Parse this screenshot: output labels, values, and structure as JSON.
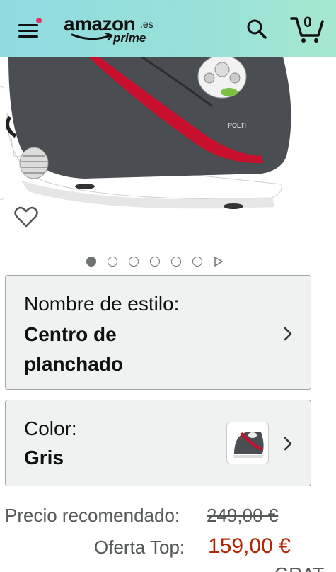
{
  "header": {
    "logo_word": "amazon",
    "logo_tld": ".es",
    "logo_sub": "prime",
    "cart_count": "0",
    "icons": [
      "hamburger-menu-icon",
      "notification-dot-icon",
      "search-icon",
      "cart-icon"
    ]
  },
  "image": {
    "brand_mark": "POLTI",
    "carousel": {
      "total": 6,
      "active_index": 0,
      "has_video": true
    }
  },
  "style_option": {
    "label": "Nombre de estilo:",
    "value_line1": "Centro de",
    "value_line2": "planchado"
  },
  "color_option": {
    "label": "Color:",
    "value": "Gris"
  },
  "price": {
    "recommended_label": "Precio recomendado:",
    "recommended_value": "249,00 €",
    "offer_label": "Oferta Top:",
    "offer_value": "159,00 €",
    "shipping_partial": "GRAT"
  },
  "colors": {
    "header_start": "#8fdbe1",
    "header_end": "#a6e8cf",
    "price_red": "#b12704",
    "card_bg": "#f0f2f2"
  }
}
